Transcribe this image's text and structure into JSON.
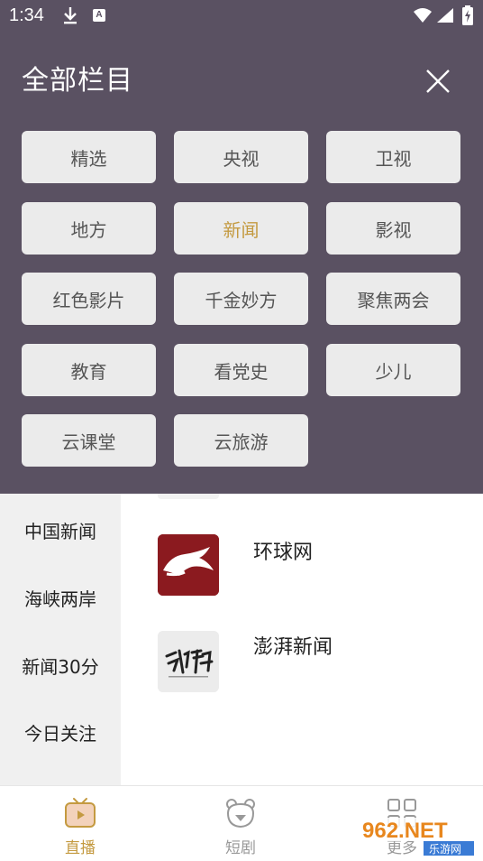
{
  "status_bar": {
    "time": "1:34",
    "icons": [
      "download-icon",
      "a-badge-icon",
      "wifi-icon",
      "signal-icon",
      "battery-charging-icon"
    ]
  },
  "panel": {
    "title": "全部栏目",
    "close_icon": "close-icon",
    "categories": [
      {
        "label": "精选",
        "active": false
      },
      {
        "label": "央视",
        "active": false
      },
      {
        "label": "卫视",
        "active": false
      },
      {
        "label": "地方",
        "active": false
      },
      {
        "label": "新闻",
        "active": true
      },
      {
        "label": "影视",
        "active": false
      },
      {
        "label": "红色影片",
        "active": false
      },
      {
        "label": "千金妙方",
        "active": false
      },
      {
        "label": "聚焦两会",
        "active": false
      },
      {
        "label": "教育",
        "active": false
      },
      {
        "label": "看党史",
        "active": false
      },
      {
        "label": "少儿",
        "active": false
      },
      {
        "label": "云课堂",
        "active": false
      },
      {
        "label": "云旅游",
        "active": false
      }
    ],
    "active_color": "#c49a40"
  },
  "sidebar": {
    "items": [
      {
        "label": "中国新闻"
      },
      {
        "label": "海峡两岸"
      },
      {
        "label": "新闻30分"
      },
      {
        "label": "今日关注"
      }
    ]
  },
  "channels": [
    {
      "label": "环球网",
      "logo": "huanqiu-logo",
      "logo_color": "#8b1a1f"
    },
    {
      "label": "澎湃新闻",
      "logo": "pengpai-logo",
      "logo_color": "#ececec"
    }
  ],
  "bottom_nav": {
    "tabs": [
      {
        "label": "直播",
        "icon": "tv-icon",
        "active": true
      },
      {
        "label": "短剧",
        "icon": "bear-icon",
        "active": false
      },
      {
        "label": "更多",
        "icon": "grid-icon",
        "active": false
      }
    ]
  },
  "watermark": {
    "text_main": "962.NET",
    "text_sub": "乐游网"
  }
}
